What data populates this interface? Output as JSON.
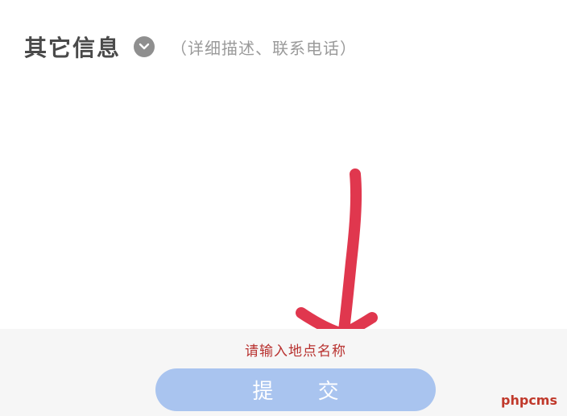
{
  "other_info": {
    "title": "其它信息",
    "hint": "（详细描述、联系电话）",
    "expand_icon": "chevron-down-icon"
  },
  "form": {
    "error_tip": "请输入地点名称",
    "submit_label": "提 交",
    "submit_color": "#a9c4ef",
    "error_color": "#b8312f"
  },
  "annotation": {
    "arrow_color": "#e0374e"
  },
  "watermark": {
    "text": "phpcms"
  }
}
